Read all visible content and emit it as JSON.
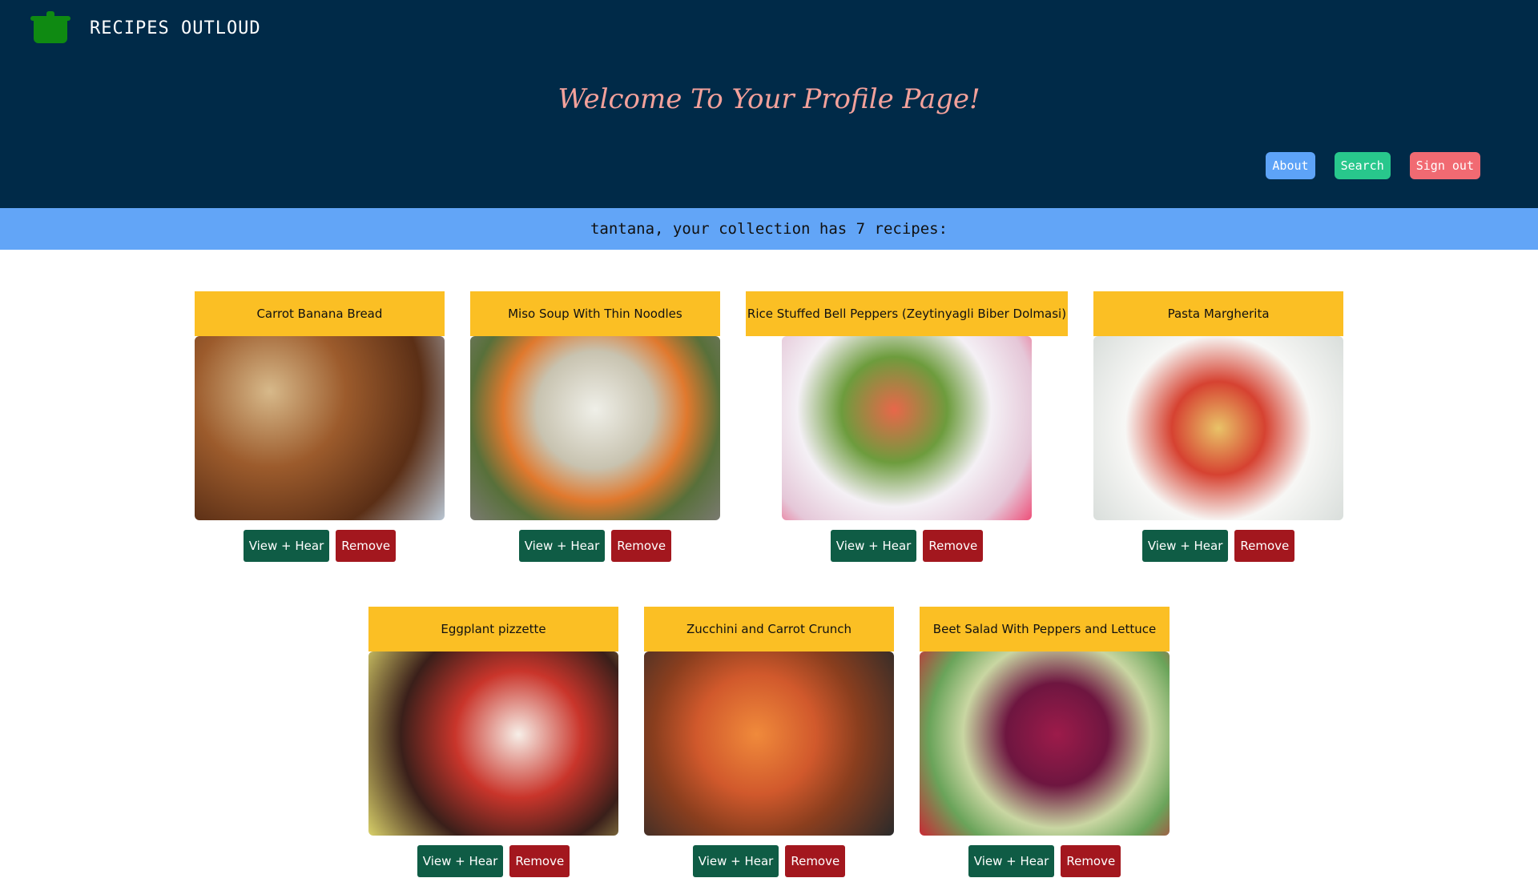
{
  "app": {
    "name": "RECIPES OUTLOUD",
    "logo_icon": "cooking-pot-icon"
  },
  "header": {
    "welcome": "Welcome To Your Profile Page!"
  },
  "nav": {
    "about": "About",
    "search": "Search",
    "sign_out": "Sign out"
  },
  "banner": {
    "text": "tantana, your collection has 7 recipes:"
  },
  "recipes": [
    {
      "title": "Carrot Banana Bread",
      "view_label": "View + Hear",
      "remove_label": "Remove"
    },
    {
      "title": "Miso Soup With Thin Noodles",
      "view_label": "View + Hear",
      "remove_label": "Remove"
    },
    {
      "title": "Rice Stuffed Bell Peppers (Zeytinyagli Biber Dolmasi)",
      "view_label": "View + Hear",
      "remove_label": "Remove"
    },
    {
      "title": "Pasta Margherita",
      "view_label": "View + Hear",
      "remove_label": "Remove"
    },
    {
      "title": "Eggplant pizzette",
      "view_label": "View + Hear",
      "remove_label": "Remove"
    },
    {
      "title": "Zucchini and Carrot Crunch",
      "view_label": "View + Hear",
      "remove_label": "Remove"
    },
    {
      "title": "Beet Salad With Peppers and Lettuce",
      "view_label": "View + Hear",
      "remove_label": "Remove"
    }
  ],
  "colors": {
    "header_bg": "#002a48",
    "banner_bg": "#62a5f7",
    "card_title_bg": "#fbbf24",
    "view_button": "#0f5c45",
    "remove_button": "#a3171e"
  }
}
